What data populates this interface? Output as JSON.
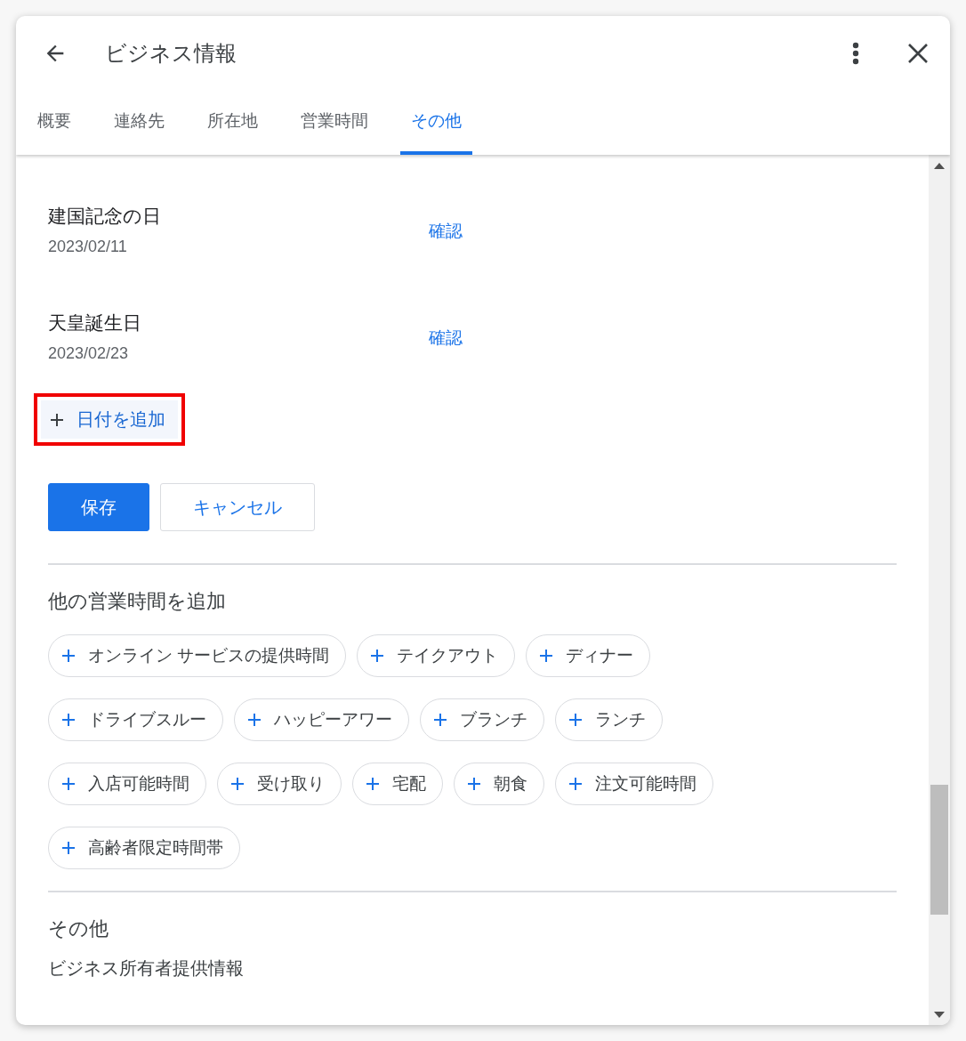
{
  "dialog": {
    "title": "ビジネス情報"
  },
  "tabs": [
    {
      "label": "概要",
      "selected": false
    },
    {
      "label": "連絡先",
      "selected": false
    },
    {
      "label": "所在地",
      "selected": false
    },
    {
      "label": "営業時間",
      "selected": false
    },
    {
      "label": "その他",
      "selected": true
    }
  ],
  "special_dates": [
    {
      "name": "建国記念の日",
      "date": "2023/02/11",
      "action": "確認"
    },
    {
      "name": "天皇誕生日",
      "date": "2023/02/23",
      "action": "確認"
    }
  ],
  "add_date_button": {
    "label": "日付を追加",
    "highlighted": true
  },
  "buttons": [
    {
      "label": "保存",
      "kind": "primary"
    },
    {
      "label": "キャンセル",
      "kind": "outline"
    }
  ],
  "more_hours": {
    "heading": "他の営業時間を追加",
    "chips": [
      [
        "オンライン サービスの提供時間",
        "テイクアウト",
        "ディナー"
      ],
      [
        "ドライブスルー",
        "ハッピーアワー",
        "ブランチ",
        "ランチ"
      ],
      [
        "入店可能時間",
        "受け取り",
        "宅配",
        "朝食",
        "注文可能時間"
      ],
      [
        "高齢者限定時間帯"
      ]
    ]
  },
  "other_section": {
    "heading": "その他",
    "subheading": "ビジネス所有者提供情報"
  }
}
